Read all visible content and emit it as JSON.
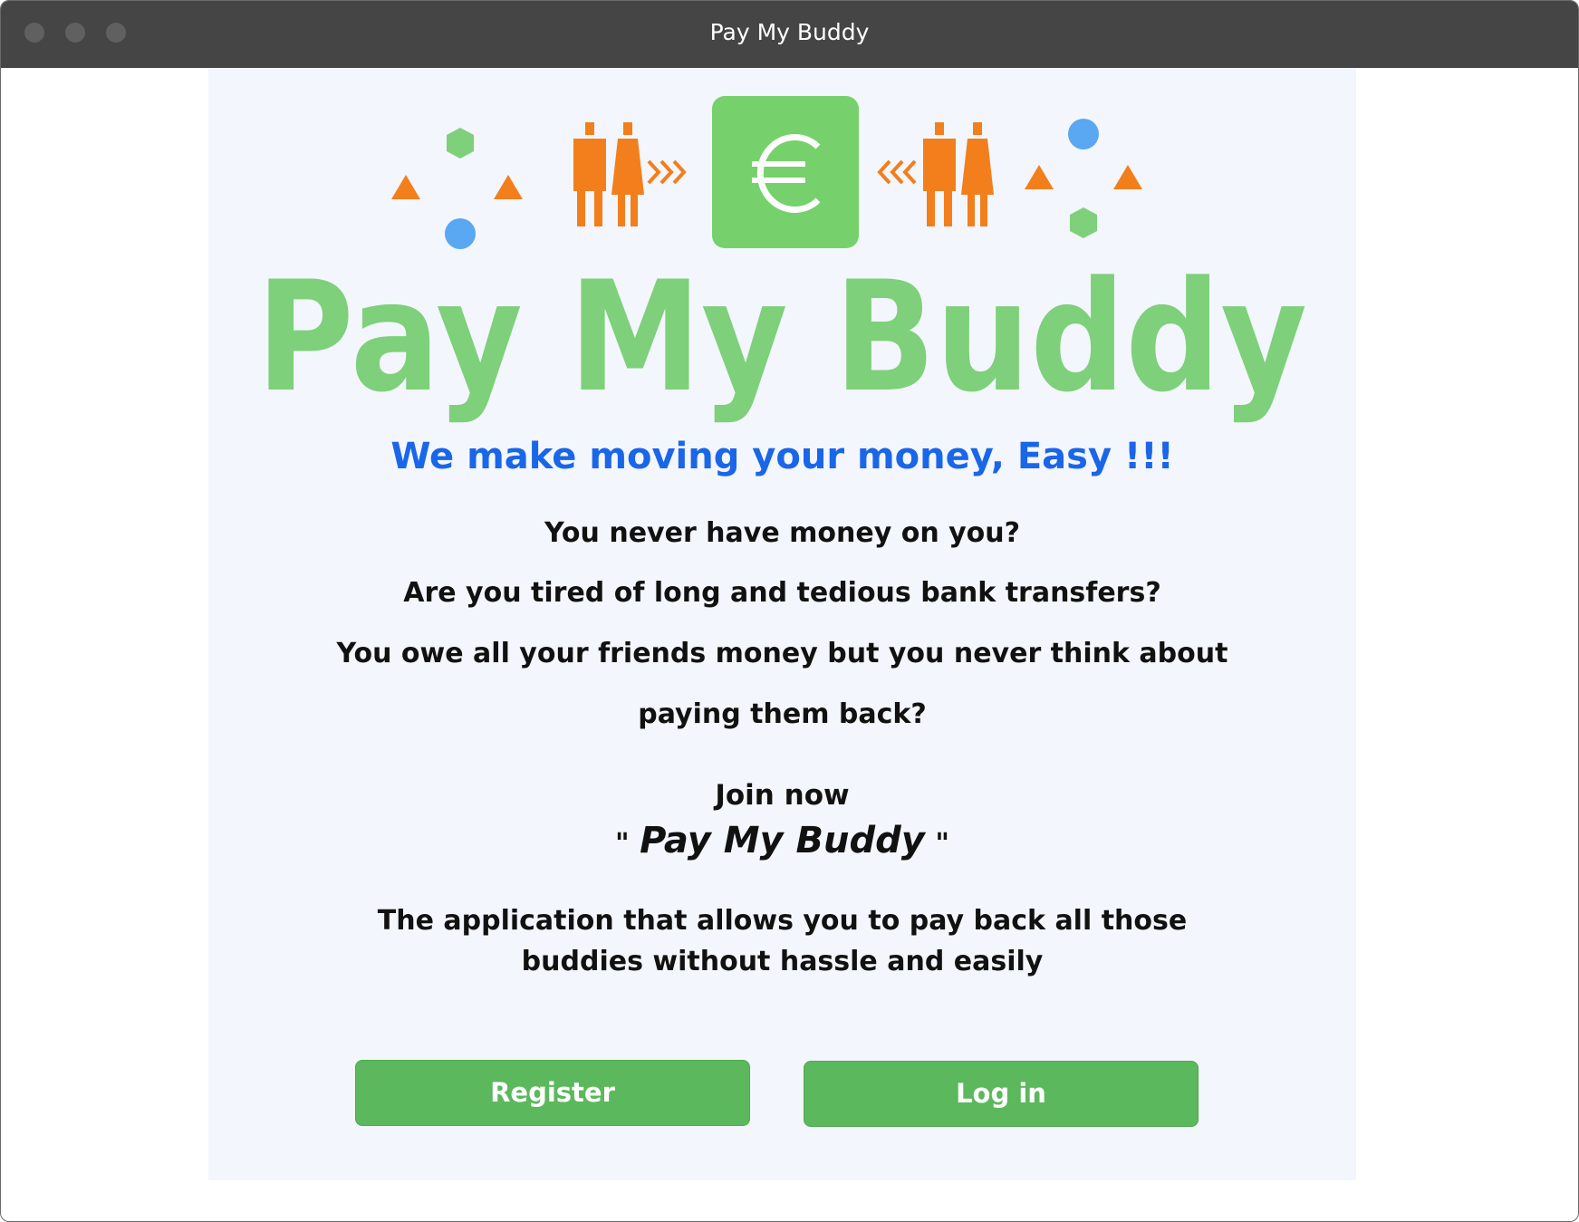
{
  "window": {
    "title": "Pay My Buddy"
  },
  "logo": {
    "wordmark": "Pay My Buddy",
    "currency_symbol": "€",
    "icons": [
      "triangle-icon",
      "hexagon-icon",
      "circle-icon",
      "person-pair-icon",
      "arrows-right-icon",
      "euro-badge-icon",
      "arrows-left-icon"
    ],
    "colors": {
      "green": "#7ed07a",
      "orange": "#f27f1c",
      "blue": "#5aa7f2"
    }
  },
  "main": {
    "tagline": "We make moving your money, Easy !!!",
    "questions": [
      "You never have money on you?",
      "Are you tired of long and tedious bank transfers?",
      "You owe all your friends money but you never think about",
      "paying them back?"
    ],
    "join_text": "Join now",
    "quote_open": "\"",
    "brand_name": "Pay My Buddy",
    "quote_close": "\"",
    "description_lines": [
      "The application that allows you to pay back all those",
      "buddies without hassle and easily"
    ]
  },
  "actions": {
    "register_label": "Register",
    "login_label": "Log in"
  },
  "colors": {
    "tagline": "#1a66e8",
    "button": "#5cb85c",
    "panel_bg": "#f3f6fc"
  }
}
